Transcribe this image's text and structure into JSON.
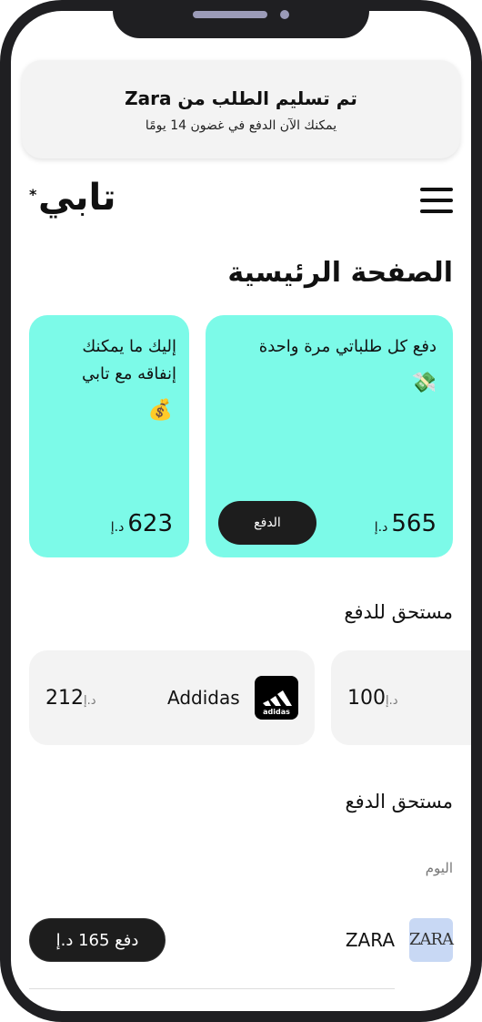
{
  "notification": {
    "title": "تم تسليم الطلب من Zara",
    "subtitle": "يمكنك الآن الدفع في غضون 14 يومًا"
  },
  "header": {
    "logo_text": "تابي",
    "logo_mark": "*",
    "menu_icon": "hamburger-menu-icon"
  },
  "page": {
    "title": "الصفحة الرئيسية"
  },
  "cards": {
    "pay_all": {
      "text": "دفع كل طلباتي مرة واحدة",
      "emoji": "💸",
      "amount": "565",
      "currency": "د.إ",
      "button_label": "الدفع"
    },
    "spend": {
      "text": "إليك ما يمكنك إنفاقه مع تابي",
      "emoji": "💰",
      "amount": "623",
      "currency": "د.إ"
    }
  },
  "due_section": {
    "title": "مستحق للدفع",
    "items": [
      {
        "brand": "Addidas",
        "amount": "212",
        "currency": "د.إ"
      },
      {
        "amount": "100",
        "currency": "د.إ"
      }
    ]
  },
  "due_list": {
    "title": "مستحق الدفع",
    "group_label": "اليوم",
    "orders": [
      {
        "logo": "ZARA",
        "name": "ZARA",
        "button_label": "دفع 165 د.إ"
      }
    ]
  },
  "colors": {
    "accent": "#7cfae8",
    "dark": "#1d1d1d",
    "card_bg": "#f3f3f3"
  }
}
